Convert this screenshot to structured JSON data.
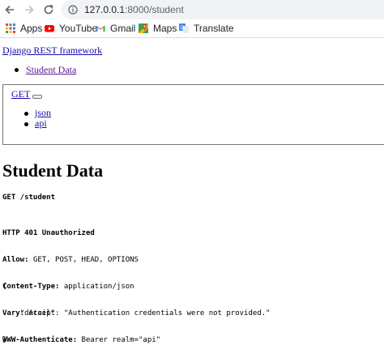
{
  "browser": {
    "url_host": "127.0.0.1",
    "url_path": ":8000/student",
    "bookmarks": [
      {
        "label": "Apps",
        "icon": "apps-grid-icon"
      },
      {
        "label": "YouTube",
        "icon": "youtube-icon"
      },
      {
        "label": "Gmail",
        "icon": "gmail-icon"
      },
      {
        "label": "Maps",
        "icon": "maps-icon"
      },
      {
        "label": "Translate",
        "icon": "translate-icon"
      }
    ]
  },
  "page": {
    "brand": "Django REST framework",
    "breadcrumb": [
      "Student Data"
    ],
    "get_button": "GET",
    "formats": [
      "json",
      "api"
    ],
    "title": "Student Data",
    "request_line": "GET /student",
    "response": {
      "status": "HTTP 401 Unauthorized",
      "headers": [
        {
          "name": "Allow:",
          "value": "GET, POST, HEAD, OPTIONS"
        },
        {
          "name": "Content-Type:",
          "value": "application/json"
        },
        {
          "name": "Vary:",
          "value": "Accept"
        },
        {
          "name": "WWW-Authenticate:",
          "value": "Bearer realm=\"api\""
        }
      ],
      "body_open": "{",
      "body_key": "\"detail\"",
      "body_sep": ": ",
      "body_value": "\"Authentication credentials were not provided.\"",
      "body_close": "}"
    }
  },
  "colors": {
    "link": "#1a0dab",
    "visited_link": "#551a8b",
    "omnibox_bg": "#f1f3f4"
  }
}
